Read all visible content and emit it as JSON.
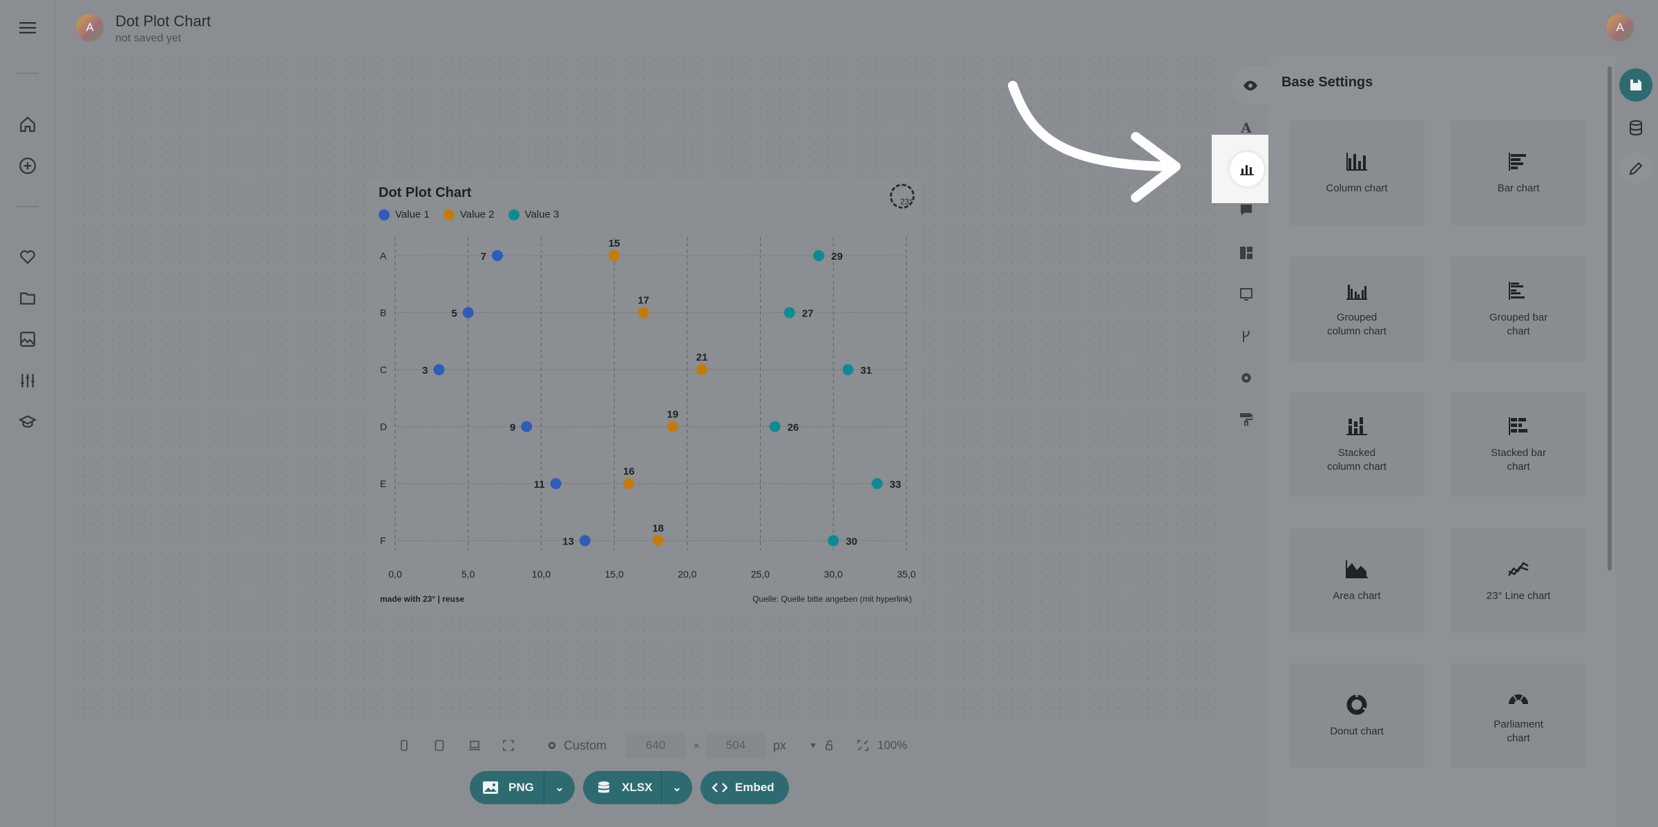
{
  "header": {
    "title": "Dot Plot Chart",
    "subtitle": "not saved yet",
    "avatar_initial": "A"
  },
  "left_nav": {
    "items": [
      "menu-icon",
      "home-icon",
      "add-circle-icon",
      "heart-icon",
      "folder-icon",
      "image-icon",
      "sliders-icon",
      "graduation-cap-icon"
    ]
  },
  "chart_card": {
    "footer_left": "made with 23° | reuse",
    "footer_right": "Quelle: Quelle bitte angeben (mit hyperlink)",
    "logo_text": "23°"
  },
  "chart_data": {
    "type": "scatter",
    "title": "Dot Plot Chart",
    "categories": [
      "A",
      "B",
      "C",
      "D",
      "E",
      "F"
    ],
    "series": [
      {
        "name": "Value 1",
        "color": "#2f5cb8",
        "values": [
          7,
          5,
          3,
          9,
          11,
          13
        ]
      },
      {
        "name": "Value 2",
        "color": "#c27c0e",
        "values": [
          15,
          17,
          21,
          19,
          16,
          18
        ]
      },
      {
        "name": "Value 3",
        "color": "#0f8a94",
        "values": [
          29,
          27,
          31,
          26,
          33,
          30
        ]
      }
    ],
    "x_ticks": [
      "0,0",
      "5,0",
      "10,0",
      "15,0",
      "20,0",
      "25,0",
      "30,0",
      "35,0"
    ],
    "xlim": [
      0,
      35
    ],
    "grid": true,
    "legend": "top-left"
  },
  "toolbar": {
    "size_preset": "Custom",
    "width": "640",
    "height": "504",
    "times": "×",
    "unit": "px",
    "zoom": "100%",
    "export_png": "PNG",
    "export_xlsx": "XLSX",
    "export_embed": "Embed"
  },
  "panel": {
    "title": "Base Settings",
    "tiles": [
      {
        "label": "Column chart",
        "icon": "column-chart-icon"
      },
      {
        "label": "Bar chart",
        "icon": "bar-chart-icon"
      },
      {
        "label": "Grouped\ncolumn chart",
        "icon": "grouped-column-chart-icon"
      },
      {
        "label": "Grouped bar\nchart",
        "icon": "grouped-bar-chart-icon"
      },
      {
        "label": "Stacked\ncolumn chart",
        "icon": "stacked-column-chart-icon"
      },
      {
        "label": "Stacked bar\nchart",
        "icon": "stacked-bar-chart-icon"
      },
      {
        "label": "Area chart",
        "icon": "area-chart-icon"
      },
      {
        "label": "23° Line chart",
        "icon": "line-chart-icon"
      },
      {
        "label": "Donut chart",
        "icon": "donut-chart-icon"
      },
      {
        "label": "Parliament\nchart",
        "icon": "parliament-chart-icon"
      }
    ]
  },
  "panel_tabs": [
    "eye-icon",
    "typography-icon",
    "chart-type-icon",
    "comment-icon",
    "layout-icon",
    "annotation-icon",
    "branch-icon",
    "gear-icon",
    "paint-roller-icon"
  ],
  "right_rail": [
    "save-icon",
    "database-icon",
    "pencil-icon"
  ],
  "colors": {
    "accent": "#2e6b70",
    "series1": "#2f5cb8",
    "series2": "#c27c0e",
    "series3": "#0f8a94"
  }
}
